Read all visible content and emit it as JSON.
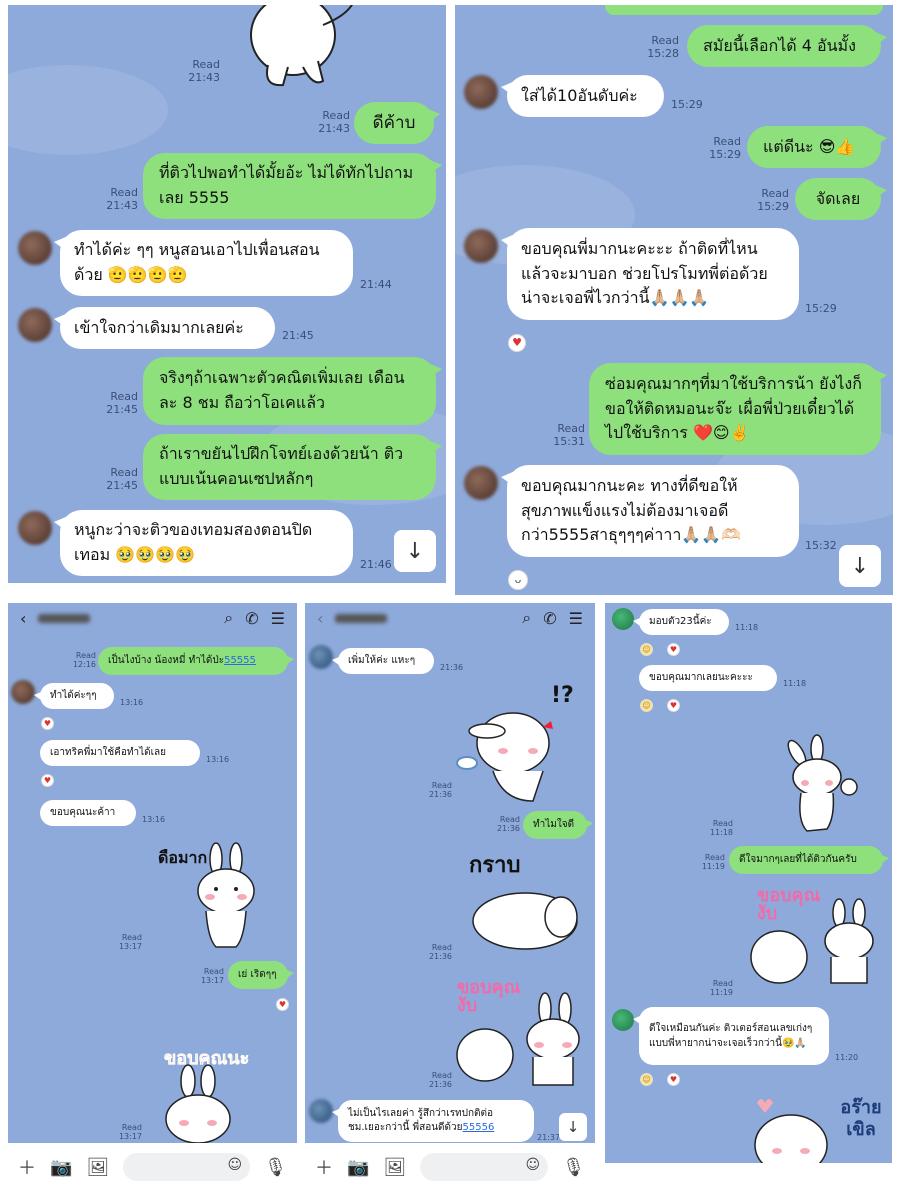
{
  "p1": {
    "read": "Read",
    "t_top": "21:43",
    "m1": {
      "text": "ดีค้าบ",
      "time": "21:43"
    },
    "m2": {
      "text": "ที่ติวไปพอทำได้มั้ยอ้ะ ไม่ได้ทักไปถามเลย 5555",
      "time": "21:43"
    },
    "m3": {
      "text": "ทำได้ค่ะ ๆๆ หนูสอนเอาไปเพื่อนสอนด้วย 🫡🫡🫡🫡",
      "time": "21:44"
    },
    "m4": {
      "text": "เข้าใจกว่าเดิมมากเลยค่ะ",
      "time": "21:45"
    },
    "m5": {
      "text": "จริงๆถ้าเฉพาะตัวคณิตเพิ่มเลย เดือนละ 8 ชม ถือว่าโอเคแล้ว",
      "time": "21:45"
    },
    "m6": {
      "text": "ถ้าเราขยันไปฝึกโจทย์เองด้วยน้า ติวแบบเน้นคอนเซปหลักๆ",
      "time": "21:45"
    },
    "m7": {
      "text": "หนูกะว่าจะติวของเทอมสองตอนปิดเทอม 🥹🥹🥹🥹",
      "time": "21:46"
    }
  },
  "p2": {
    "read": "Read",
    "m1": {
      "text": "สมัยนี้เลือกได้ 4 อันมั้ง",
      "time": "15:28"
    },
    "m2": {
      "text": "ใส่ได้10อันดับค่ะ",
      "time": "15:29"
    },
    "m3": {
      "text": "แต่ดีนะ 😎👍",
      "time": "15:29"
    },
    "m4": {
      "text": "จัดเลย",
      "time": "15:29"
    },
    "m5": {
      "text": "ขอบคุณพี่มากนะคะะะ ถ้าติดที่ไหนแล้วจะมาบอก ช่วยโปรโมทพี่ต่อด้วย น่าจะเจอพี่ไวกว่านี้🙏🏼🙏🏼🙏🏼",
      "time": "15:29"
    },
    "m6": {
      "text": "ซ่อมคุณมากๆที่มาใช้บริการน้า ยังไงก็ขอให้ติดหมอนะจ๊ะ เผื่อพี่ป่วยเดี๋ยวได้ไปใช้บริการ ❤️😊✌️",
      "time": "15:31"
    },
    "m7": {
      "text": "ขอบคุณมากนะคะ ทางที่ดีขอให้สุขภาพแข็งแรงไม่ต้องมาเจอดีกว่า5555สาธุๆๆๆค่าาา🙏🏼🙏🏼🫶🏻",
      "time": "15:32"
    }
  },
  "p3": {
    "read": "Read",
    "m1": {
      "text": "เป็นไงบ้าง น้องหมี่ ทำได้ป่ะ ",
      "link": "55555",
      "time": "12:16"
    },
    "m2": {
      "text": "ทำได้ค่ะๆๆ",
      "time": "13:16"
    },
    "m3": {
      "text": "เอาทริคพี่มาใช้คือทำได้เลย",
      "time": "13:16"
    },
    "m4": {
      "text": "ขอบคุณนะค้าา",
      "time": "13:16"
    },
    "sticker1_text": "ดือมาก",
    "sticker1_time": "13:17",
    "m5": {
      "text": "เย่ เริดๆๆ",
      "time": "13:17"
    },
    "sticker2_text": "ขอบคุณนะ",
    "sticker2_time": "13:17"
  },
  "p4": {
    "read": "Read",
    "m1": {
      "text": "เพิ่มให้ค่ะ แหะๆ",
      "time": "21:36"
    },
    "sticker1_text": "!?",
    "sticker1_time": "21:36",
    "m2": {
      "text": "ทำไมใจดี",
      "time": "21:36"
    },
    "sticker2_text": "กราบ",
    "sticker2_time": "21:36",
    "sticker3_text": "ขอบคุณงับ",
    "sticker3_time": "21:36",
    "m3": {
      "text": "ไม่เป็นไรเลยค่า รู้สึกว่าเรทปกติต่อชม.เยอะกว่านี้ พี่สอนดีด้วย",
      "link": "55556",
      "time": "21:37"
    }
  },
  "p5": {
    "read": "Read",
    "m1": {
      "text": "มอบตัว23นี้ค่ะ",
      "time": "11:18"
    },
    "m2": {
      "text": "ขอบคุณมากเลยนะคะะะ",
      "time": "11:18"
    },
    "sticker1_time": "11:18",
    "m3": {
      "text": "ดีใจมากๆเลยที่ได้ติวกันครับ",
      "time": "11:19"
    },
    "sticker2_text": "ขอบคุณงับ",
    "sticker2_time": "11:19",
    "m4": {
      "text": "ดีใจเหมือนกันค่ะ ติวเตอร์สอนเลขเก่งๆแบบพี่หายากน่าจะเจอเร็วกว่านี้🥹🙏🏼",
      "time": "11:20"
    },
    "sticker3_text": "อร๊าย เขิล"
  },
  "colors": {
    "bg": "#8eaadb",
    "green": "#8ee07c",
    "white": "#ffffff",
    "link": "#2a6be0"
  }
}
